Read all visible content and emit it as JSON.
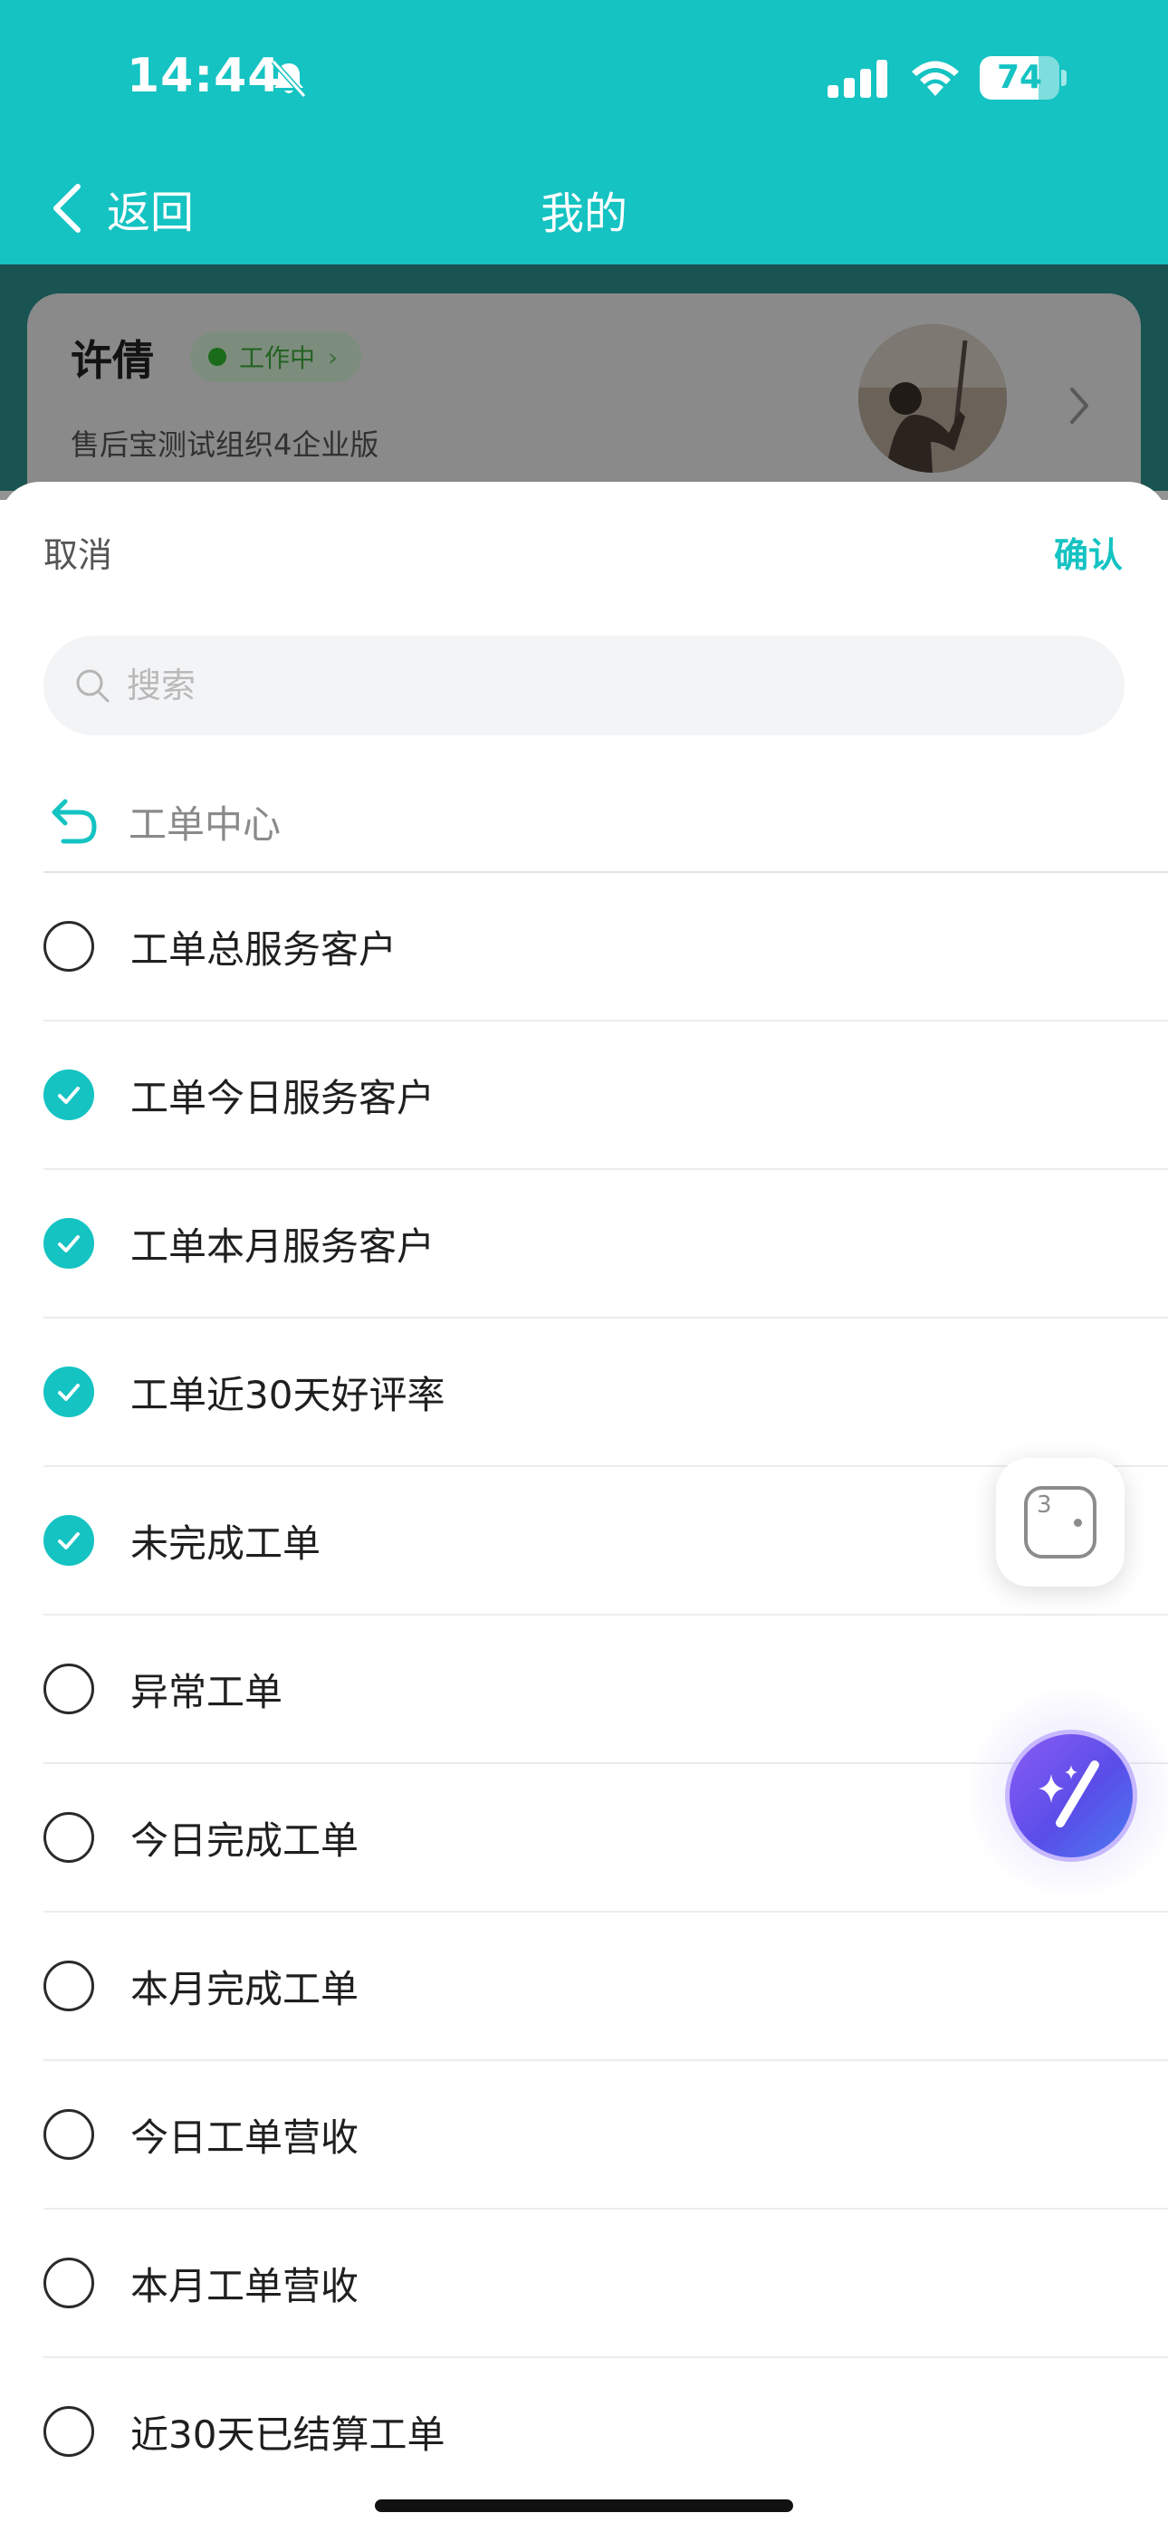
{
  "status_bar": {
    "time": "14:44",
    "battery_level": "74",
    "battery_fraction": 0.74,
    "icons": [
      "bell-muted-icon",
      "signal-icon",
      "wifi-icon",
      "battery-icon"
    ]
  },
  "nav": {
    "back_label": "返回",
    "title": "我的"
  },
  "profile": {
    "name": "许倩",
    "status_badge": "工作中",
    "organization": "售后宝测试组织4企业版"
  },
  "sheet": {
    "cancel_label": "取消",
    "confirm_label": "确认",
    "search": {
      "placeholder": "搜索",
      "value": ""
    },
    "breadcrumb": "工单中心",
    "options": [
      {
        "label": "工单总服务客户",
        "checked": false
      },
      {
        "label": "工单今日服务客户",
        "checked": true
      },
      {
        "label": "工单本月服务客户",
        "checked": true
      },
      {
        "label": "工单近30天好评率",
        "checked": true
      },
      {
        "label": "未完成工单",
        "checked": true
      },
      {
        "label": "异常工单",
        "checked": false
      },
      {
        "label": "今日完成工单",
        "checked": false
      },
      {
        "label": "本月完成工单",
        "checked": false
      },
      {
        "label": "今日工单营收",
        "checked": false
      },
      {
        "label": "本月工单营收",
        "checked": false
      },
      {
        "label": "近30天已结算工单",
        "checked": false
      }
    ]
  },
  "float_widget": {
    "number": "3"
  },
  "colors": {
    "brand_teal": "#14c3c2",
    "ai_purple": "#5a4de8",
    "status_green": "#2eb82e"
  }
}
